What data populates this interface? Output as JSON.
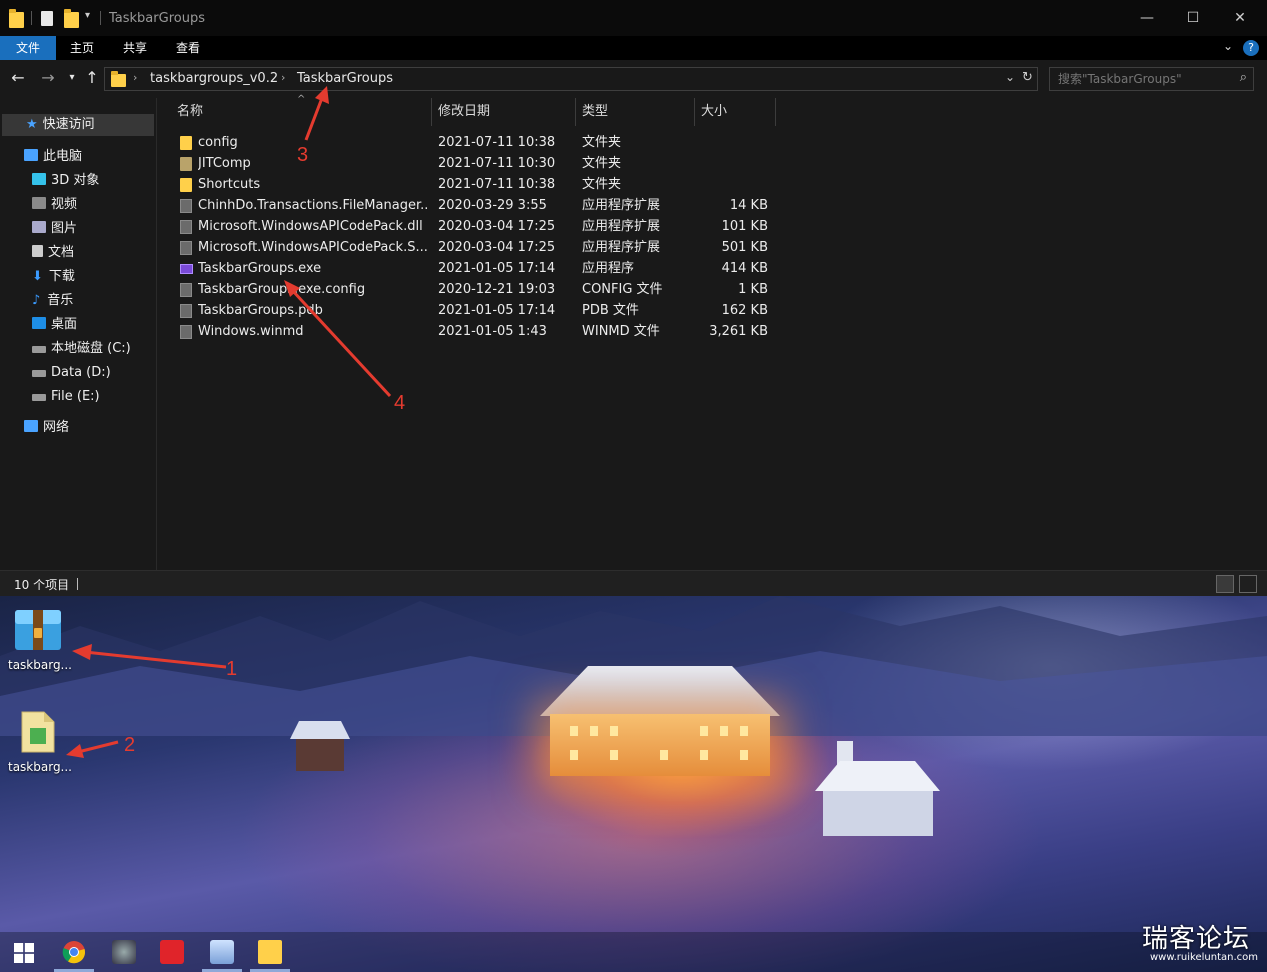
{
  "window": {
    "title": "TaskbarGroups",
    "controls": {
      "minimize": "—",
      "maximize": "☐",
      "close": "✕"
    }
  },
  "ribbon": {
    "tabs": [
      "文件",
      "主页",
      "共享",
      "查看"
    ],
    "help": "?"
  },
  "address": {
    "crumbs": [
      "taskbargroups_v0.2",
      "TaskbarGroups"
    ],
    "refresh": "↻"
  },
  "search": {
    "placeholder": "搜索\"TaskbarGroups\""
  },
  "navpane": {
    "quick_access": "快速访问",
    "this_pc": "此电脑",
    "items": [
      "3D 对象",
      "视频",
      "图片",
      "文档",
      "下载",
      "音乐",
      "桌面",
      "本地磁盘 (C:)",
      "Data (D:)",
      "File (E:)"
    ],
    "network": "网络"
  },
  "columns": {
    "name": "名称",
    "date": "修改日期",
    "type": "类型",
    "size": "大小"
  },
  "files": [
    {
      "name": "config",
      "date": "2021-07-11 10:38",
      "type": "文件夹",
      "size": "",
      "icon": "folder"
    },
    {
      "name": "JITComp",
      "date": "2021-07-11 10:30",
      "type": "文件夹",
      "size": "",
      "icon": "folder-dim"
    },
    {
      "name": "Shortcuts",
      "date": "2021-07-11 10:38",
      "type": "文件夹",
      "size": "",
      "icon": "folder"
    },
    {
      "name": "ChinhDo.Transactions.FileManager....",
      "date": "2020-03-29 3:55",
      "type": "应用程序扩展",
      "size": "14 KB",
      "icon": "file"
    },
    {
      "name": "Microsoft.WindowsAPICodePack.dll",
      "date": "2020-03-04 17:25",
      "type": "应用程序扩展",
      "size": "101 KB",
      "icon": "file"
    },
    {
      "name": "Microsoft.WindowsAPICodePack.S...",
      "date": "2020-03-04 17:25",
      "type": "应用程序扩展",
      "size": "501 KB",
      "icon": "file"
    },
    {
      "name": "TaskbarGroups.exe",
      "date": "2021-01-05 17:14",
      "type": "应用程序",
      "size": "414 KB",
      "icon": "exe"
    },
    {
      "name": "TaskbarGroups.exe.config",
      "date": "2020-12-21 19:03",
      "type": "CONFIG 文件",
      "size": "1 KB",
      "icon": "file"
    },
    {
      "name": "TaskbarGroups.pdb",
      "date": "2021-01-05 17:14",
      "type": "PDB 文件",
      "size": "162 KB",
      "icon": "file"
    },
    {
      "name": "Windows.winmd",
      "date": "2021-01-05 1:43",
      "type": "WINMD 文件",
      "size": "3,261 KB",
      "icon": "file"
    }
  ],
  "status": {
    "count": "10 个项目"
  },
  "desktop": {
    "icons": [
      {
        "label": "taskbarg...",
        "kind": "archive-icon"
      },
      {
        "label": "taskbarg...",
        "kind": "document-icon"
      }
    ]
  },
  "annotations": [
    "1",
    "2",
    "3",
    "4"
  ],
  "watermark": {
    "text": "瑞客论坛",
    "url": "www.ruikeluntan.com"
  },
  "colors": {
    "accent": "#1a6fbd",
    "annotation": "#e43b2f",
    "folder": "#ffd04a"
  }
}
